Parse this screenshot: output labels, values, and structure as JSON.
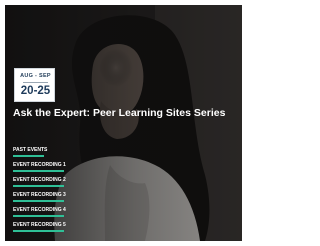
{
  "event": {
    "month_range": "AUG - SEP",
    "day_range": "20-25",
    "title": "Ask the Expert: Peer Learning Sites Series"
  },
  "nav": {
    "items": [
      {
        "label": "PAST EVENTS"
      },
      {
        "label": "EVENT RECORDING 1"
      },
      {
        "label": "EVENT RECORDING 2"
      },
      {
        "label": "EVENT RECORDING 3"
      },
      {
        "label": "EVENT RECORDING 4"
      },
      {
        "label": "EVENT RECORDING 5"
      }
    ]
  },
  "colors": {
    "accent_underline": "#2fbf96",
    "badge_text": "#1d3a5a",
    "overlay": "#1f1d1c"
  }
}
